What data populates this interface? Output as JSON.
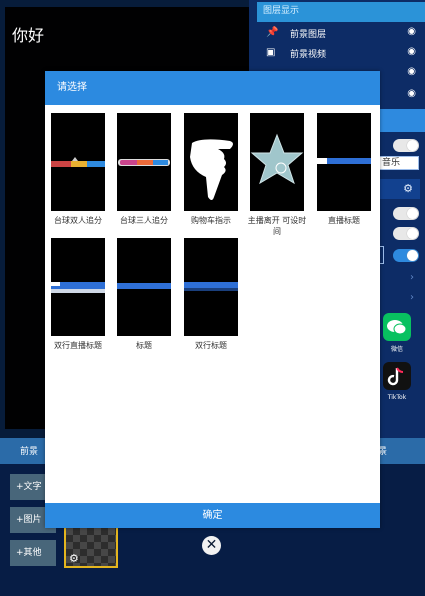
{
  "preview": {
    "greeting": "你好"
  },
  "layers": {
    "header": "图层显示",
    "rows": [
      {
        "label": "前景图层",
        "icon": "pin-icon"
      },
      {
        "label": "前景视频",
        "icon": "video-icon"
      },
      {
        "label": "",
        "icon": "eye-icon"
      },
      {
        "label": "",
        "icon": "eye-icon"
      }
    ]
  },
  "right_panel": {
    "music_label": "音乐"
  },
  "apps": [
    {
      "name": "wechat-app",
      "label": "微信",
      "color": "#08c160"
    },
    {
      "name": "tiktok-app",
      "label": "TikTok",
      "color": "#000000"
    }
  ],
  "bottom_bar": {
    "left_label": "前景",
    "right_label": "景"
  },
  "side_buttons": [
    {
      "label": "+文字"
    },
    {
      "label": "+图片"
    },
    {
      "label": "+其他"
    }
  ],
  "dialog": {
    "title": "请选择",
    "confirm_label": "确定",
    "items": [
      {
        "caption": "台球双人追分",
        "preview": "billiards-double"
      },
      {
        "caption": "台球三人追分",
        "preview": "billiards-triple"
      },
      {
        "caption": "购物车指示",
        "preview": "hand-pointer"
      },
      {
        "caption": "主播离开 可设时间",
        "preview": "star-badge"
      },
      {
        "caption": "直播标题",
        "preview": "live-title-bar"
      },
      {
        "caption": "双行直播标题",
        "preview": "double-live-title"
      },
      {
        "caption": "标题",
        "preview": "title-bar"
      },
      {
        "caption": "双行标题",
        "preview": "double-title"
      }
    ]
  },
  "colors": {
    "accent": "#2c8ae0",
    "background": "#071c3a"
  }
}
